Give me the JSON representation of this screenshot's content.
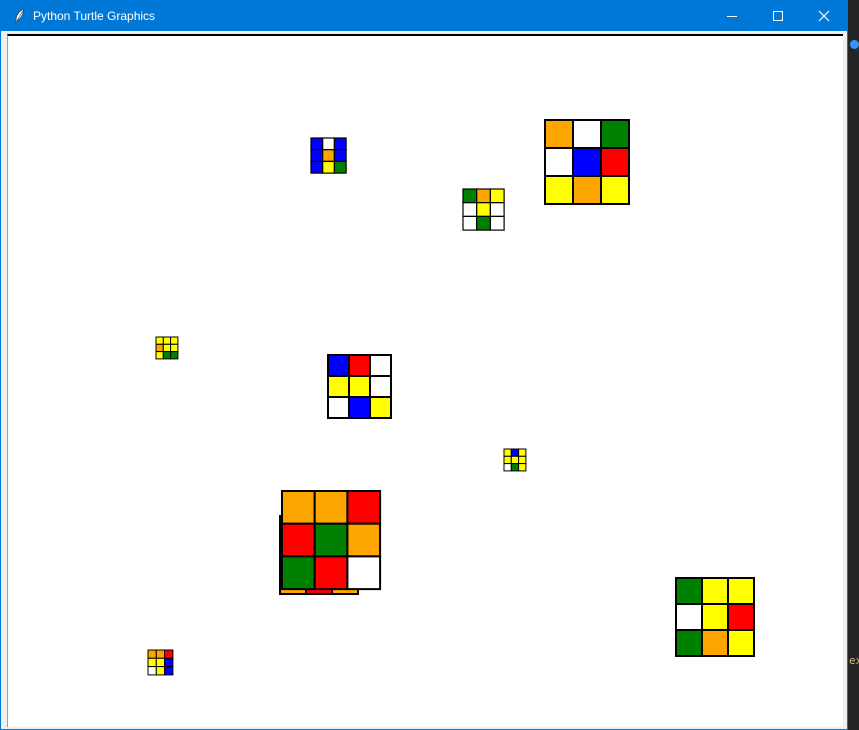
{
  "window": {
    "title": "Python Turtle Graphics",
    "controls": {
      "minimize": "minimize",
      "maximize": "maximize",
      "close": "close"
    }
  },
  "palette": {
    "O": "#ffa500",
    "W": "#ffffff",
    "G": "#008000",
    "B": "#0000ff",
    "R": "#ff0000",
    "Y": "#ffff00",
    "titlebar": "#0078d7",
    "stroke": "#000000"
  },
  "cubes": [
    {
      "name": "cube-small-blue",
      "colors": [
        "B",
        "W",
        "B",
        "B",
        "O",
        "B",
        "B",
        "Y",
        "G"
      ]
    },
    {
      "name": "cube-large-orange-top",
      "colors": [
        "O",
        "W",
        "G",
        "W",
        "B",
        "R",
        "Y",
        "O",
        "Y"
      ]
    },
    {
      "name": "cube-small-green-top",
      "colors": [
        "G",
        "O",
        "Y",
        "W",
        "Y",
        "W",
        "W",
        "G",
        "W"
      ]
    },
    {
      "name": "cube-tiny-left",
      "colors": [
        "Y",
        "Y",
        "Y",
        "O",
        "Y",
        "Y",
        "Y",
        "G",
        "G"
      ]
    },
    {
      "name": "cube-medium-center",
      "colors": [
        "B",
        "R",
        "W",
        "Y",
        "Y",
        "W",
        "W",
        "B",
        "Y"
      ]
    },
    {
      "name": "cube-tiny-right",
      "colors": [
        "Y",
        "B",
        "Y",
        "Y",
        "Y",
        "Y",
        "W",
        "G",
        "Y"
      ]
    },
    {
      "name": "cube-large-bottom",
      "colors": [
        "O",
        "O",
        "R",
        "R",
        "G",
        "O",
        "G",
        "R",
        "W"
      ]
    },
    {
      "name": "cube-large-bottom-right",
      "colors": [
        "G",
        "Y",
        "Y",
        "W",
        "Y",
        "R",
        "G",
        "O",
        "Y"
      ]
    },
    {
      "name": "cube-tiny-bottom-left",
      "colors": [
        "O",
        "O",
        "R",
        "Y",
        "Y",
        "B",
        "W",
        "Y",
        "B"
      ]
    }
  ],
  "side_strip": {
    "text": "ex"
  }
}
